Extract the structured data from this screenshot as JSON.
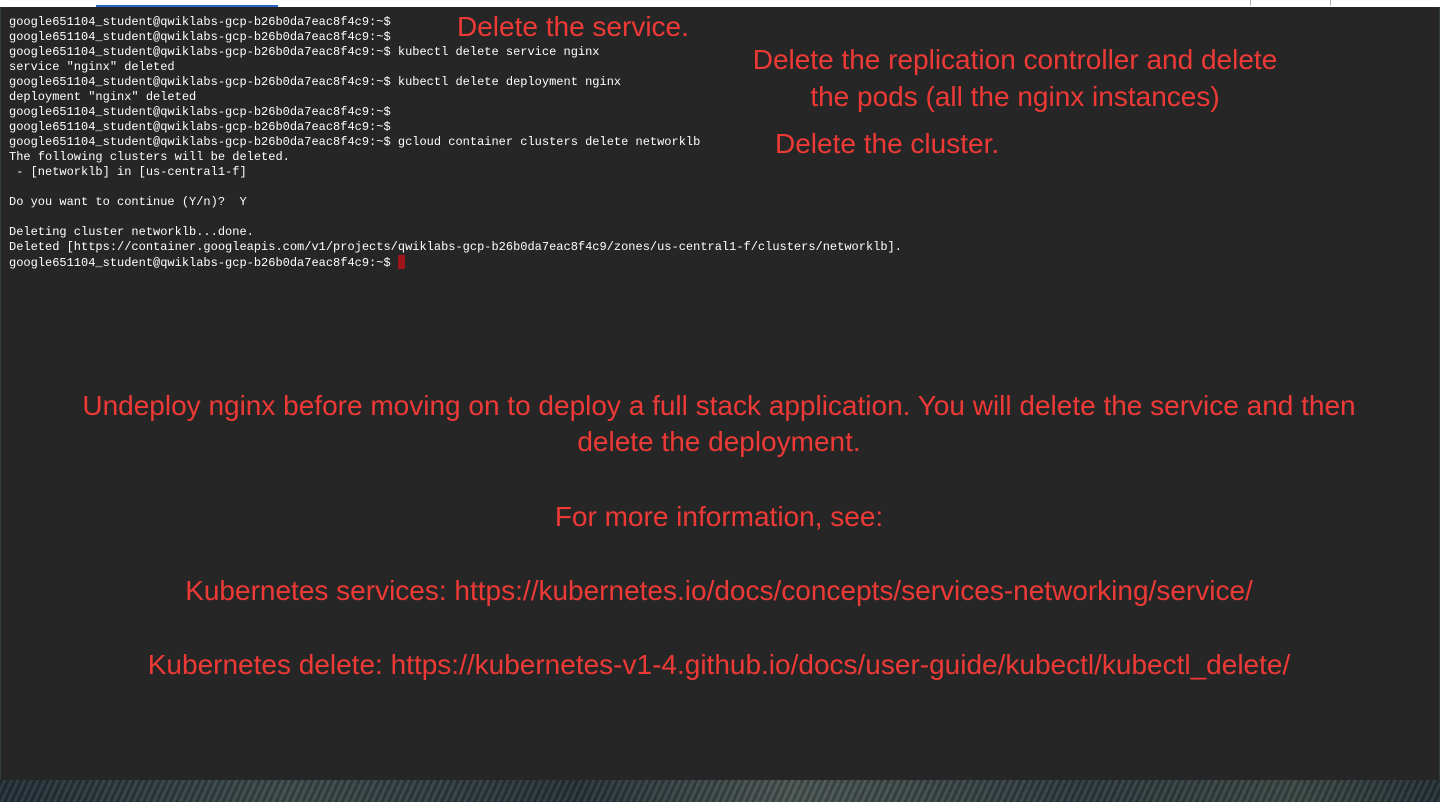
{
  "terminal": {
    "lines": [
      "google651104_student@qwiklabs-gcp-b26b0da7eac8f4c9:~$",
      "google651104_student@qwiklabs-gcp-b26b0da7eac8f4c9:~$",
      "google651104_student@qwiklabs-gcp-b26b0da7eac8f4c9:~$ kubectl delete service nginx",
      "service \"nginx\" deleted",
      "google651104_student@qwiklabs-gcp-b26b0da7eac8f4c9:~$ kubectl delete deployment nginx",
      "deployment \"nginx\" deleted",
      "google651104_student@qwiklabs-gcp-b26b0da7eac8f4c9:~$",
      "google651104_student@qwiklabs-gcp-b26b0da7eac8f4c9:~$",
      "google651104_student@qwiklabs-gcp-b26b0da7eac8f4c9:~$ gcloud container clusters delete networklb",
      "The following clusters will be deleted.",
      " - [networklb] in [us-central1-f]",
      "",
      "Do you want to continue (Y/n)?  Y",
      "",
      "Deleting cluster networklb...done.",
      "Deleted [https://container.googleapis.com/v1/projects/qwiklabs-gcp-b26b0da7eac8f4c9/zones/us-central1-f/clusters/networklb]."
    ],
    "prompt": "google651104_student@qwiklabs-gcp-b26b0da7eac8f4c9:~$"
  },
  "annotations": {
    "delete_service": "Delete the service.",
    "delete_rc_line1": "Delete the replication controller and delete",
    "delete_rc_line2": "the pods (all the nginx instances)",
    "delete_cluster": "Delete the cluster.",
    "undeploy_line1": "Undeploy nginx before moving on to deploy a full stack application. You will delete the service and then",
    "undeploy_line2": "delete the deployment.",
    "more_info": "For more information, see:",
    "k8s_services": "Kubernetes services: https://kubernetes.io/docs/concepts/services-networking/service/",
    "k8s_delete": "Kubernetes delete: https://kubernetes-v1-4.github.io/docs/user-guide/kubectl/kubectl_delete/"
  },
  "colors": {
    "annotation": "#ee3a36",
    "terminal_bg": "#262626",
    "terminal_text": "#ffffff",
    "cursor": "#a0141c"
  }
}
